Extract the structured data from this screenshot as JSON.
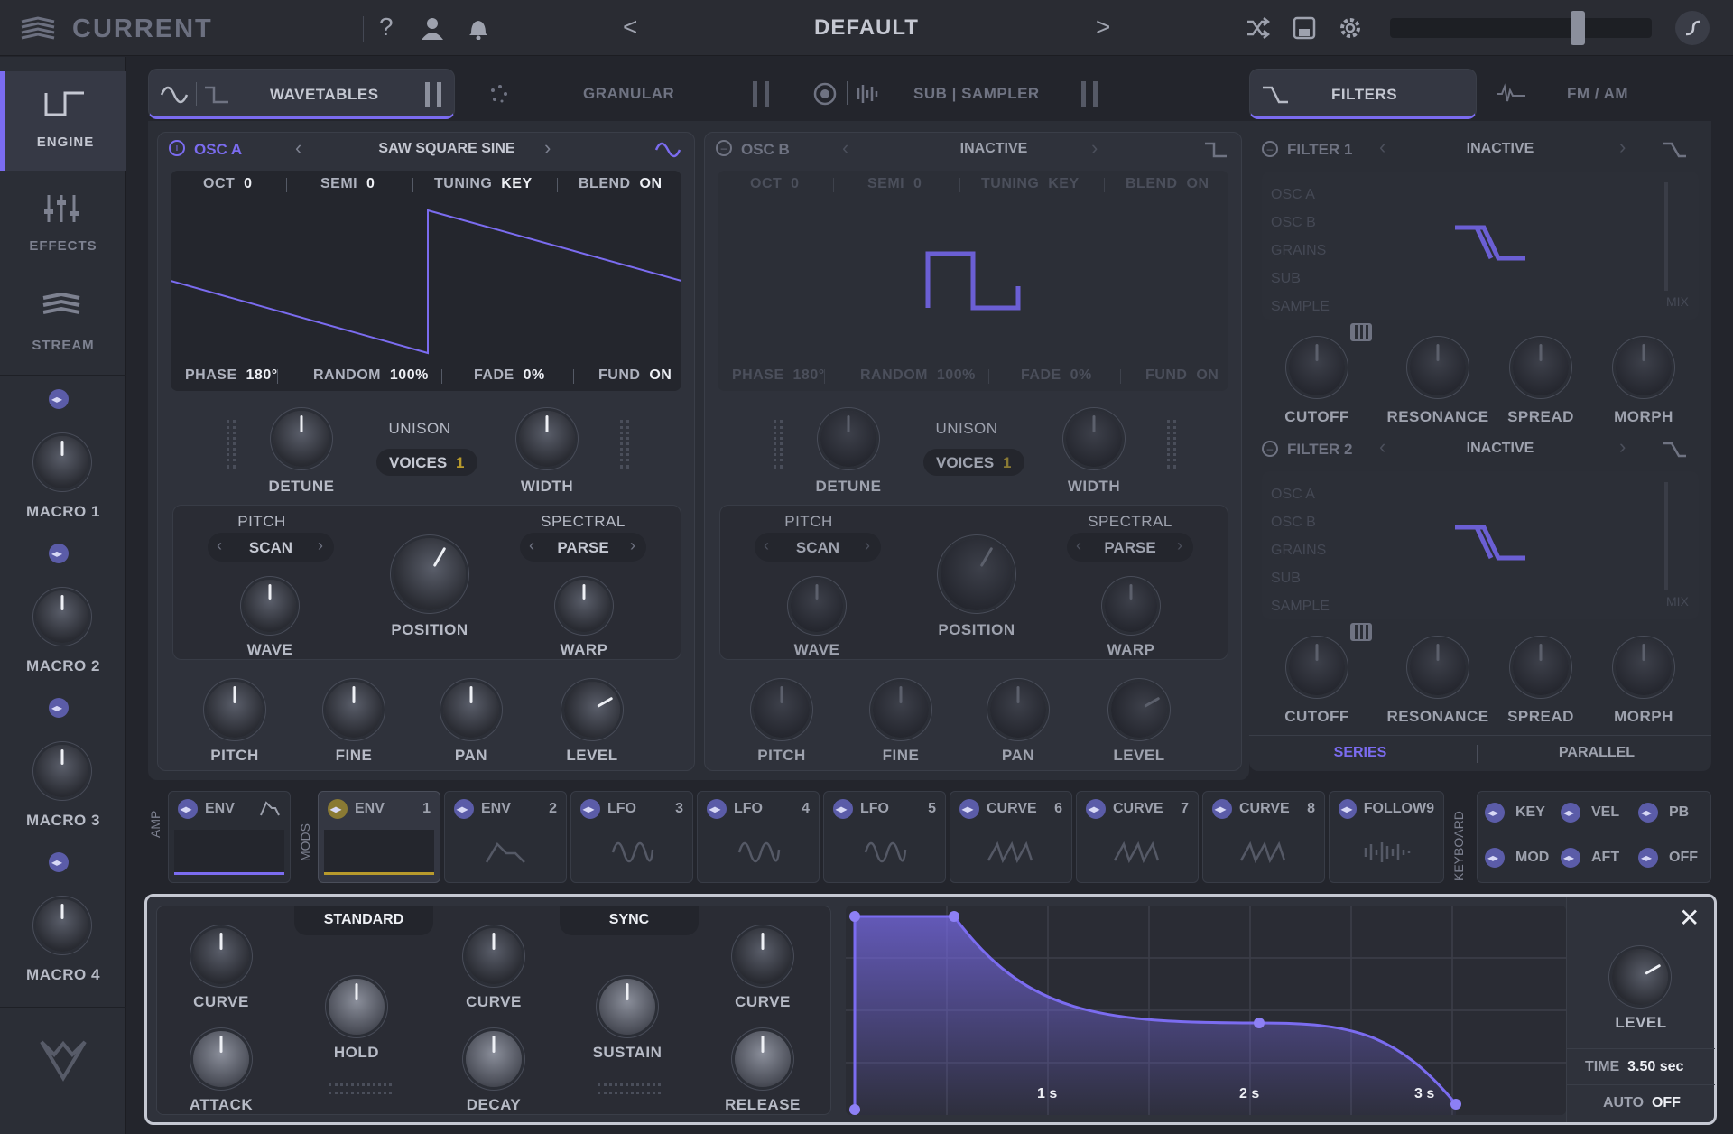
{
  "app": {
    "title": "CURRENT",
    "preset": "DEFAULT",
    "prev": "<",
    "next": ">"
  },
  "sidebar": {
    "tabs": [
      {
        "label": "ENGINE"
      },
      {
        "label": "EFFECTS"
      },
      {
        "label": "STREAM"
      }
    ],
    "macros": [
      {
        "label": "MACRO 1"
      },
      {
        "label": "MACRO 2"
      },
      {
        "label": "MACRO 3"
      },
      {
        "label": "MACRO 4"
      }
    ]
  },
  "tabs": {
    "wavetables": "WAVETABLES",
    "granular": "GRANULAR",
    "sub_sampler": "SUB | SAMPLER",
    "filters": "FILTERS",
    "fm_am": "FM / AM"
  },
  "oscA": {
    "title": "OSC A",
    "table": "SAW SQUARE SINE",
    "oct_l": "OCT",
    "oct": "0",
    "semi_l": "SEMI",
    "semi": "0",
    "tuning_l": "TUNING",
    "tuning": "KEY",
    "blend_l": "BLEND",
    "blend": "ON",
    "phase_l": "PHASE",
    "phase": "180°",
    "random_l": "RANDOM",
    "random": "100%",
    "fade_l": "FADE",
    "fade": "0%",
    "fund_l": "FUND",
    "fund": "ON",
    "unison": "UNISON",
    "voices_l": "VOICES",
    "voices": "1",
    "detune": "DETUNE",
    "width": "WIDTH",
    "pitch_sec": "PITCH",
    "spectral_sec": "SPECTRAL",
    "scan": "SCAN",
    "parse": "PARSE",
    "wave": "WAVE",
    "position": "POSITION",
    "warp": "WARP",
    "pitch": "PITCH",
    "fine": "FINE",
    "pan": "PAN",
    "level": "LEVEL"
  },
  "oscB": {
    "title": "OSC B",
    "table": "INACTIVE",
    "oct_l": "OCT",
    "oct": "0",
    "semi_l": "SEMI",
    "semi": "0",
    "tuning_l": "TUNING",
    "tuning": "KEY",
    "blend_l": "BLEND",
    "blend": "ON",
    "phase_l": "PHASE",
    "phase": "180°",
    "random_l": "RANDOM",
    "random": "100%",
    "fade_l": "FADE",
    "fade": "0%",
    "fund_l": "FUND",
    "fund": "ON",
    "unison": "UNISON",
    "voices_l": "VOICES",
    "voices": "1",
    "detune": "DETUNE",
    "width": "WIDTH",
    "pitch_sec": "PITCH",
    "spectral_sec": "SPECTRAL",
    "scan": "SCAN",
    "parse": "PARSE",
    "wave": "WAVE",
    "position": "POSITION",
    "warp": "WARP",
    "pitch": "PITCH",
    "fine": "FINE",
    "pan": "PAN",
    "level": "LEVEL"
  },
  "filter1": {
    "title": "FILTER 1",
    "state": "INACTIVE",
    "sources": [
      "OSC A",
      "OSC B",
      "GRAINS",
      "SUB",
      "SAMPLE"
    ],
    "mix": "MIX",
    "cutoff": "CUTOFF",
    "resonance": "RESONANCE",
    "spread": "SPREAD",
    "morph": "MORPH"
  },
  "filter2": {
    "title": "FILTER 2",
    "state": "INACTIVE",
    "sources": [
      "OSC A",
      "OSC B",
      "GRAINS",
      "SUB",
      "SAMPLE"
    ],
    "mix": "MIX",
    "cutoff": "CUTOFF",
    "resonance": "RESONANCE",
    "spread": "SPREAD",
    "morph": "MORPH"
  },
  "routing": {
    "series": "SERIES",
    "parallel": "PARALLEL"
  },
  "mods": {
    "amp_label": "AMP",
    "mods_label": "MODS",
    "keyboard_label": "KEYBOARD",
    "amp": {
      "name": "ENV"
    },
    "tiles": [
      {
        "name": "ENV",
        "n": "1"
      },
      {
        "name": "ENV",
        "n": "2"
      },
      {
        "name": "LFO",
        "n": "3"
      },
      {
        "name": "LFO",
        "n": "4"
      },
      {
        "name": "LFO",
        "n": "5"
      },
      {
        "name": "CURVE",
        "n": "6"
      },
      {
        "name": "CURVE",
        "n": "7"
      },
      {
        "name": "CURVE",
        "n": "8"
      },
      {
        "name": "FOLLOW",
        "n": "9"
      }
    ],
    "keyboard": [
      "KEY",
      "VEL",
      "PB",
      "MOD",
      "AFT",
      "OFF"
    ]
  },
  "env": {
    "standard": "STANDARD",
    "sync": "SYNC",
    "curve1": "CURVE",
    "curve2": "CURVE",
    "curve3": "CURVE",
    "hold": "HOLD",
    "sustain": "SUSTAIN",
    "attack": "ATTACK",
    "decay": "DECAY",
    "release": "RELEASE",
    "ticks": [
      "1 s",
      "2 s",
      "3 s"
    ],
    "level": "LEVEL",
    "time_l": "TIME",
    "time": "3.50 sec",
    "auto_l": "AUTO",
    "auto": "OFF"
  },
  "colors": {
    "accent": "#7b6cf0",
    "bg": "#23252c",
    "panel": "#2f323b",
    "yellow": "#b89a2c"
  }
}
